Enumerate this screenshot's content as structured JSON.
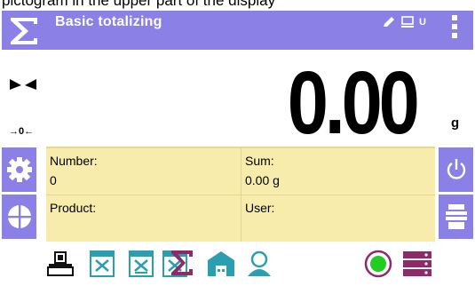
{
  "caption": "pictogram in the upper part of the display",
  "titlebar": {
    "title": "Basic totalizing",
    "status_letter": "U"
  },
  "display": {
    "value": "0.00",
    "unit": "g",
    "zero_indicator": "→0←"
  },
  "info": {
    "number_label": "Number:",
    "number_value": "0",
    "sum_label": "Sum:",
    "sum_value": "0.00 g",
    "product_label": "Product:",
    "product_value": "",
    "user_label": "User:",
    "user_value": ""
  },
  "icons": {
    "settings": "gear-icon",
    "database": "database-icon",
    "tare": "tare-icon",
    "power": "power-icon",
    "printer": "printer-icon",
    "zero": "zero-icon",
    "status_led": "green-status-icon",
    "server": "server-icon"
  },
  "colors": {
    "accent": "#8a80e6",
    "info_bg": "#f7ecab",
    "sigma": "#8e2a6a",
    "teal": "#2a9fb0",
    "led": "#22cc22"
  }
}
